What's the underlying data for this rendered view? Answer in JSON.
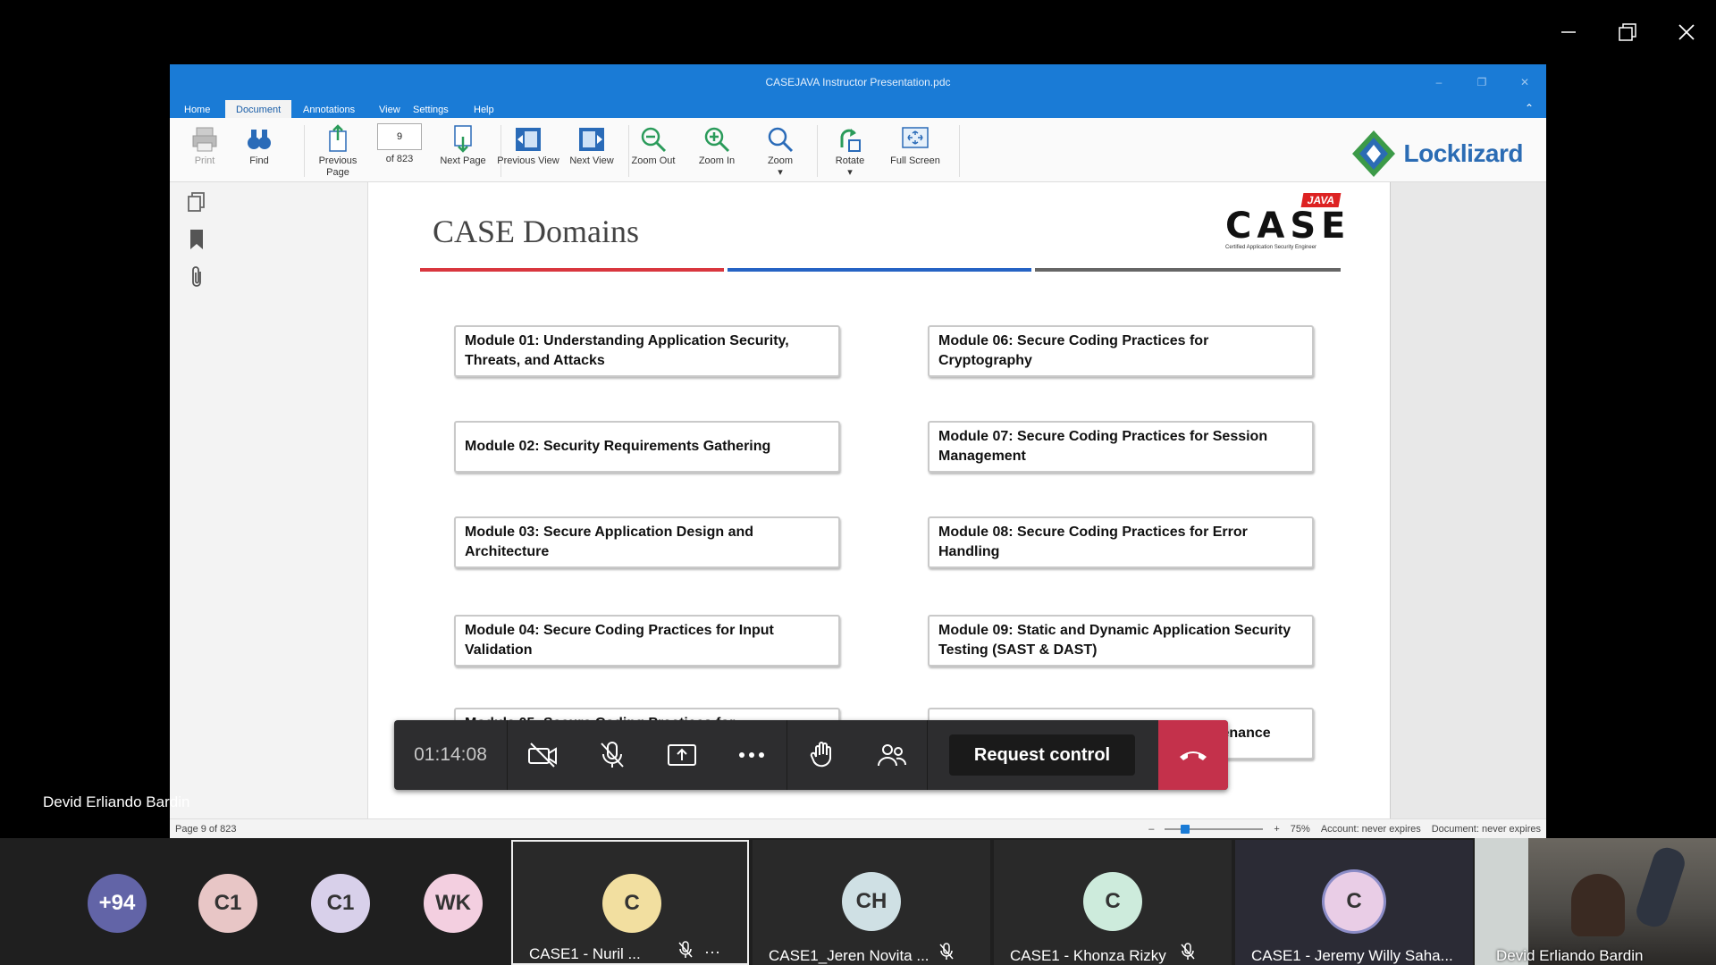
{
  "viewer": {
    "title": "CASEJAVA Instructor Presentation.pdc",
    "menu": [
      "Home",
      "Document",
      "Annotations",
      "View",
      "Settings",
      "Help"
    ],
    "active_menu": "Document",
    "toolbar": {
      "print": "Print",
      "find": "Find",
      "previous_page": "Previous Page",
      "page_number": "9",
      "page_of": "of 823",
      "next_page": "Next Page",
      "previous_view": "Previous View",
      "next_view": "Next View",
      "zoom_out": "Zoom Out",
      "zoom_in": "Zoom In",
      "zoom": "Zoom",
      "rotate": "Rotate",
      "full_screen": "Full Screen"
    },
    "brand": "Locklizard",
    "status": {
      "page": "Page 9 of 823",
      "zoom": "75%",
      "account": "Account: never expires",
      "document": "Document: never expires"
    }
  },
  "slide": {
    "title": "CASE Domains",
    "logo": {
      "badge": "JAVA",
      "letters": "CASE",
      "subtitle": "Certified Application Security Engineer"
    },
    "modules_left": [
      "Module 01: Understanding Application Security, Threats, and Attacks",
      "Module 02: Security Requirements Gathering",
      "Module 03: Secure Application Design and Architecture",
      "Module 04: Secure Coding Practices for Input Validation",
      "Module 05: Secure Coding Practices for Authentication and Authorization"
    ],
    "modules_right": [
      "Module 06: Secure Coding Practices for Cryptography",
      "Module 07: Secure Coding Practices for Session Management",
      "Module 08: Secure Coding Practices for Error Handling",
      "Module 09: Static and Dynamic Application Security Testing (SAST & DAST)",
      "Module 10: Secure Deployment and Maintenance"
    ],
    "rule_colors": [
      "#d9363e",
      "#2563c4",
      "#666666"
    ]
  },
  "call": {
    "timer": "01:14:08",
    "request_control": "Request control",
    "presenter": "Devid Erliando Bardin",
    "hangup_color": "#c4314b"
  },
  "gallery": {
    "overflow": "+94",
    "avatars": [
      {
        "initials": "C1",
        "color": "#e8c6c6"
      },
      {
        "initials": "C1",
        "color": "#d8d0ea"
      },
      {
        "initials": "WK",
        "color": "#f3cfe0"
      }
    ],
    "tiles": [
      {
        "initials": "C",
        "name": "CASE1 - Nuril ...",
        "color": "#f2dfa0"
      },
      {
        "initials": "CH",
        "name": "CASE1_Jeren Novita ...",
        "color": "#cfe0e4"
      },
      {
        "initials": "C",
        "name": "CASE1 - Khonza Rizky",
        "color": "#cdebdc"
      },
      {
        "initials": "C",
        "name": "CASE1 - Jeremy Willy Saha...",
        "color": "#e9cde6"
      }
    ],
    "camera_name": "Devid Erliando Bardin"
  }
}
